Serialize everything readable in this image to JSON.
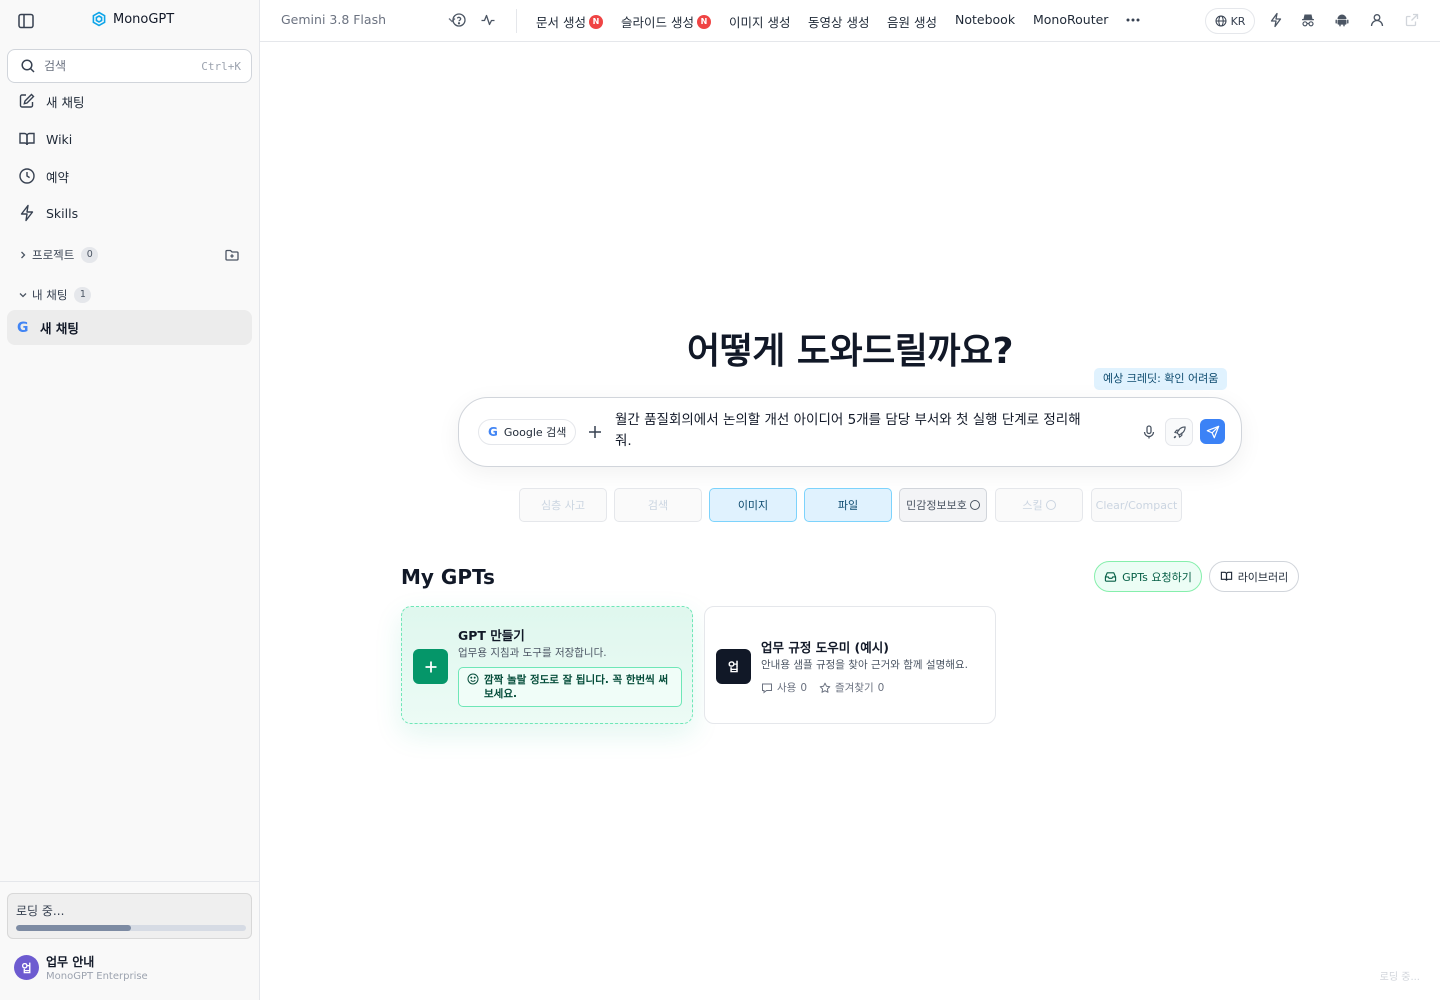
{
  "sidebar": {
    "brand": "MonoGPT",
    "search": {
      "placeholder": "검색",
      "shortcut": "Ctrl+K"
    },
    "nav": [
      {
        "label": "새 채팅",
        "icon": "pencil-square-icon"
      },
      {
        "label": "Wiki",
        "icon": "book-icon"
      },
      {
        "label": "예약",
        "icon": "clock-icon"
      },
      {
        "label": "Skills",
        "icon": "bolt-icon"
      }
    ],
    "projects": {
      "label": "프로젝트",
      "count": "0"
    },
    "chats": {
      "label": "내 채팅",
      "count": "1",
      "items": [
        {
          "label": "새 채팅",
          "icon": "google-g-icon"
        }
      ]
    },
    "loading": {
      "text": "로딩 중...",
      "progress": 0.5
    },
    "user": {
      "avatar": "업",
      "name": "업무 안내",
      "org": "MonoGPT Enterprise"
    }
  },
  "topbar": {
    "model": "Gemini 3.8 Flash",
    "menus": [
      {
        "label": "문서 생성",
        "badge": "N"
      },
      {
        "label": "슬라이드 생성",
        "badge": "N"
      },
      {
        "label": "이미지 생성"
      },
      {
        "label": "동영상 생성"
      },
      {
        "label": "음원 생성"
      },
      {
        "label": "Notebook"
      },
      {
        "label": "MonoRouter"
      }
    ],
    "lang": "KR"
  },
  "main": {
    "hero": "어떻게 도와드릴까요?",
    "credit_badge": "예상 크레딧: 확인 어려움",
    "composer": {
      "tool_chip": "Google 검색",
      "prompt": "월간 품질회의에서 논의할 개선 아이디어 5개를 담당 부서와 첫 실행 단계로 정리해줘."
    },
    "chips": [
      {
        "label": "심층 사고",
        "state": "disabled"
      },
      {
        "label": "검색",
        "state": "disabled"
      },
      {
        "label": "이미지",
        "state": "active"
      },
      {
        "label": "파일",
        "state": "active"
      },
      {
        "label": "민감정보보호",
        "state": "toggle"
      },
      {
        "label": "스킬",
        "state": "disabled-toggle"
      },
      {
        "label": "Clear/Compact",
        "state": "disabled"
      }
    ],
    "gpts": {
      "title": "My GPTs",
      "request_label": "GPTs 요청하기",
      "library_label": "라이브러리",
      "create_card": {
        "title": "GPT 만들기",
        "desc": "업무용 지침과 도구를 저장합니다.",
        "tip": "깜짝 놀랄 정도로 잘 됩니다. 꼭 한번씩 써보세요."
      },
      "cards": [
        {
          "avatar": "업",
          "title": "업무 규정 도우미 (예시)",
          "desc": "안내용 샘플 규정을 찾아 근거와 함께 설명해요.",
          "uses_label": "사용",
          "uses": "0",
          "fav_label": "즐겨찾기",
          "favs": "0"
        }
      ]
    },
    "corner_status": "로딩 중..."
  },
  "colors": {
    "accent": "#3b82f6",
    "brand_green": "#059669",
    "badge_red": "#ef4444"
  }
}
